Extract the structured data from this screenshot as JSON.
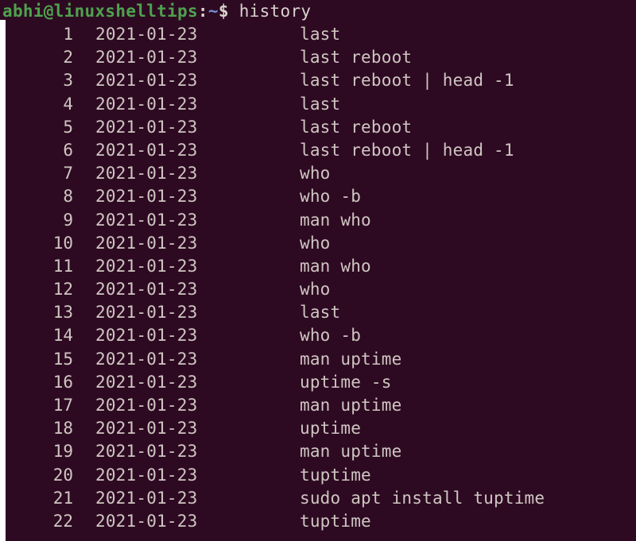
{
  "terminal": {
    "background_color": "#2e0a22",
    "foreground_color": "#cfc6c2",
    "prompt": {
      "user_host": "abhi@linuxshelltips",
      "user_host_color": "#4ea24e",
      "colon": ":",
      "path": "~",
      "path_color": "#6f8fd8",
      "dollar": "$",
      "command": " history"
    },
    "history_columns": [
      "index",
      "date",
      "command"
    ],
    "history": [
      {
        "index": "1",
        "date": "2021-01-23",
        "command": "last"
      },
      {
        "index": "2",
        "date": "2021-01-23",
        "command": "last reboot"
      },
      {
        "index": "3",
        "date": "2021-01-23",
        "command": "last reboot | head -1"
      },
      {
        "index": "4",
        "date": "2021-01-23",
        "command": "last"
      },
      {
        "index": "5",
        "date": "2021-01-23",
        "command": "last reboot"
      },
      {
        "index": "6",
        "date": "2021-01-23",
        "command": "last reboot | head -1"
      },
      {
        "index": "7",
        "date": "2021-01-23",
        "command": "who"
      },
      {
        "index": "8",
        "date": "2021-01-23",
        "command": "who -b"
      },
      {
        "index": "9",
        "date": "2021-01-23",
        "command": "man who"
      },
      {
        "index": "10",
        "date": "2021-01-23",
        "command": "who"
      },
      {
        "index": "11",
        "date": "2021-01-23",
        "command": "man who"
      },
      {
        "index": "12",
        "date": "2021-01-23",
        "command": "who"
      },
      {
        "index": "13",
        "date": "2021-01-23",
        "command": "last"
      },
      {
        "index": "14",
        "date": "2021-01-23",
        "command": "who -b"
      },
      {
        "index": "15",
        "date": "2021-01-23",
        "command": "man uptime"
      },
      {
        "index": "16",
        "date": "2021-01-23",
        "command": "uptime -s"
      },
      {
        "index": "17",
        "date": "2021-01-23",
        "command": "man uptime"
      },
      {
        "index": "18",
        "date": "2021-01-23",
        "command": "uptime"
      },
      {
        "index": "19",
        "date": "2021-01-23",
        "command": "man uptime"
      },
      {
        "index": "20",
        "date": "2021-01-23",
        "command": "tuptime"
      },
      {
        "index": "21",
        "date": "2021-01-23",
        "command": "sudo apt install tuptime"
      },
      {
        "index": "22",
        "date": "2021-01-23",
        "command": "tuptime"
      }
    ]
  }
}
